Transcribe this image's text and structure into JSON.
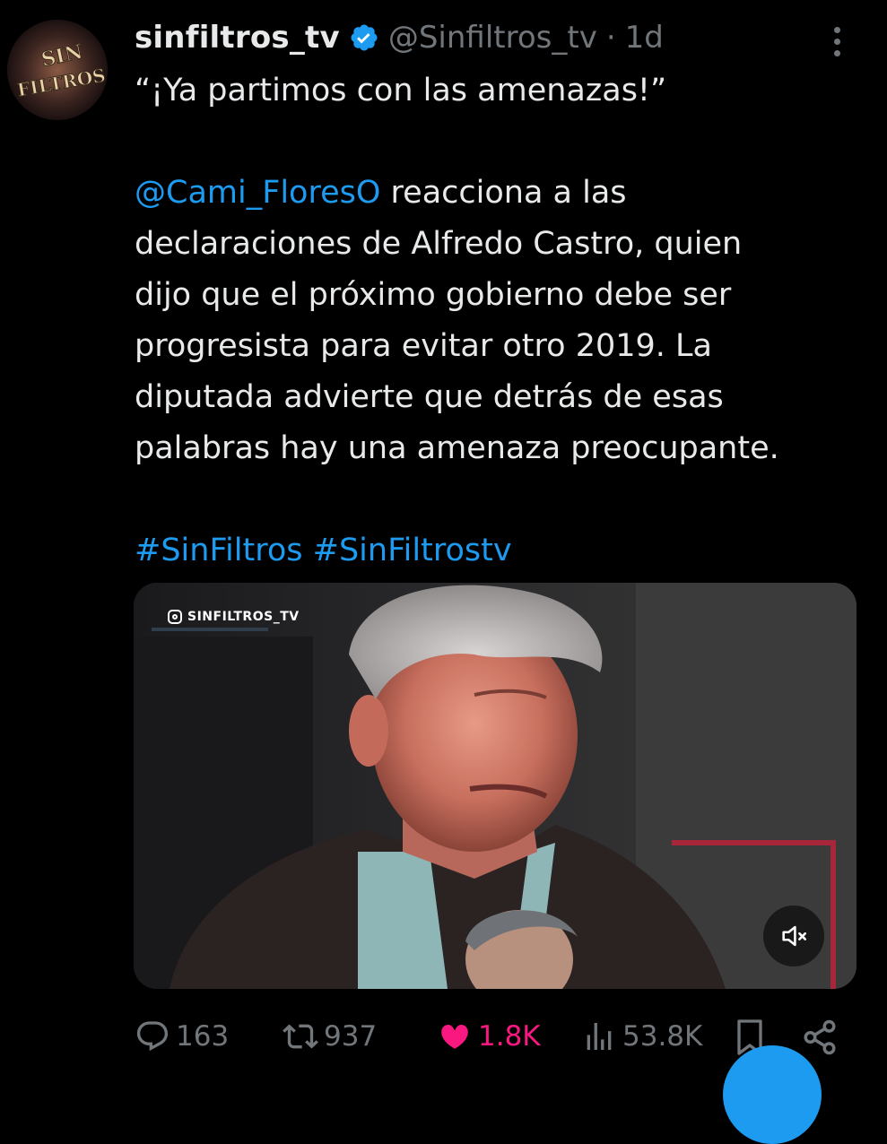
{
  "author": {
    "display_name": "sinfiltros_tv",
    "handle": "@Sinfiltros_tv",
    "separator": "·",
    "time": "1d",
    "avatar_text": [
      "SIN",
      "FILTROS"
    ]
  },
  "tweet": {
    "quote_line": "“¡Ya partimos con las amenazas!”",
    "mention": "@Cami_FloresO",
    "body_line1_rest": " reacciona a las",
    "body_line2": "declaraciones de Alfredo Castro, quien",
    "body_line3": "dijo que el próximo gobierno debe ser",
    "body_line4": "progresista para evitar otro 2019. La",
    "body_line5": "diputada advierte que detrás de esas",
    "body_line6": "palabras hay una amenaza preocupante.",
    "hashtags": [
      "#SinFiltros",
      "#SinFiltrostv"
    ]
  },
  "media": {
    "type": "video",
    "watermark": "SINFILTROS_TV",
    "muted": true
  },
  "stats": {
    "replies": "163",
    "reposts": "937",
    "likes": "1.8K",
    "liked": true,
    "views": "53.8K"
  },
  "colors": {
    "background": "#000000",
    "text": "#e7e9ea",
    "muted": "#71767b",
    "link": "#1d9bf0",
    "like": "#f91880"
  }
}
